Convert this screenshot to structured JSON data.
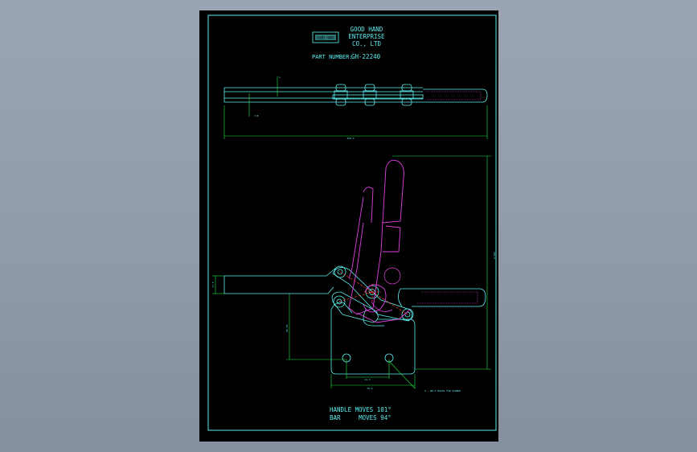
{
  "title_block": {
    "company_line1": "GOOD HAND",
    "company_line2": "ENTERPRISE",
    "company_line3": "CO., LTD",
    "logo_text": "GOOD HAND",
    "part_number_label": "PART NUMBER:",
    "part_number": "GH-22240"
  },
  "notes": {
    "handle_moves": "HANDLE MOVES 101°",
    "bar_moves": "BAR     MOVES 94°"
  },
  "dimensions": {
    "top_small": "L",
    "top_left": "7/8",
    "top_overall": "292.6",
    "side_height": "260.6",
    "side_left": "17.5",
    "side_vertical": "80.95",
    "base_spacing": "41.3",
    "base_width": "79.4",
    "hole_note": "4 - Ø8.5 HOLES FOR SCREWS"
  },
  "colors": {
    "outline": "#5ff0f0",
    "dimension": "#22e84a",
    "handle": "#e040e0",
    "center": "#ff3030",
    "sheet": "#000000"
  }
}
